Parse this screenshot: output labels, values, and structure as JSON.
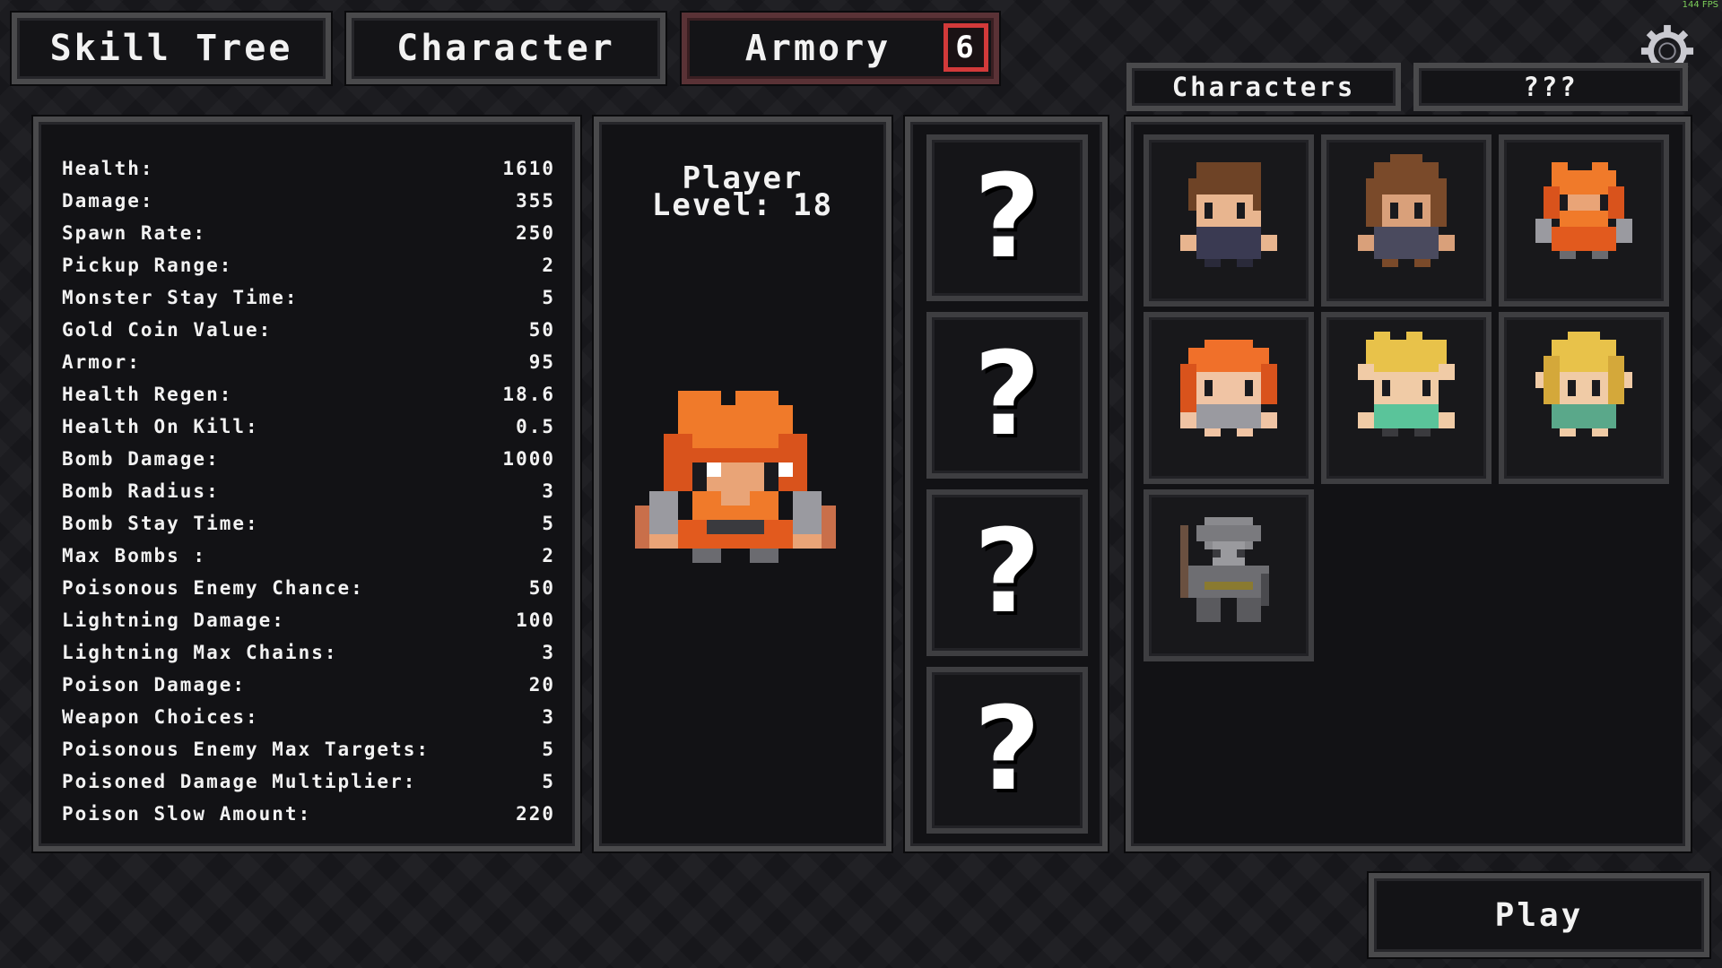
{
  "tabs": {
    "skill_tree": "Skill Tree",
    "character": "Character",
    "armory": "Armory",
    "armory_badge": "6"
  },
  "fps": "144 FPS",
  "stats": [
    {
      "label": "Health:",
      "value": "1610"
    },
    {
      "label": "Damage:",
      "value": "355"
    },
    {
      "label": "Spawn Rate:",
      "value": "250"
    },
    {
      "label": "Pickup Range:",
      "value": "2"
    },
    {
      "label": "Monster Stay Time:",
      "value": "5"
    },
    {
      "label": "Gold Coin Value:",
      "value": "50"
    },
    {
      "label": "Armor:",
      "value": "95"
    },
    {
      "label": "Health Regen:",
      "value": "18.6"
    },
    {
      "label": "Health On Kill:",
      "value": "0.5"
    },
    {
      "label": "Bomb Damage:",
      "value": "1000"
    },
    {
      "label": "Bomb Radius:",
      "value": "3"
    },
    {
      "label": "Bomb Stay Time:",
      "value": "5"
    },
    {
      "label": "Max Bombs :",
      "value": "2"
    },
    {
      "label": "Poisonous Enemy Chance:",
      "value": "50"
    },
    {
      "label": "Lightning Damage:",
      "value": "100"
    },
    {
      "label": "Lightning Max Chains:",
      "value": "3"
    },
    {
      "label": "Poison Damage:",
      "value": "20"
    },
    {
      "label": "Weapon Choices:",
      "value": "3"
    },
    {
      "label": "Poisonous Enemy Max Targets:",
      "value": "5"
    },
    {
      "label": "Poisoned Damage Multiplier:",
      "value": "5"
    },
    {
      "label": "Poison Slow Amount:",
      "value": "220"
    }
  ],
  "player": {
    "line1": "Player",
    "line2": "Level: 18",
    "sprite": "orange-haired-bearded-warrior"
  },
  "mystery_slots": [
    "?",
    "?",
    "?",
    "?"
  ],
  "character_tabs": {
    "characters": "Characters",
    "unknown": "???"
  },
  "characters": [
    "brown-haired-boy",
    "brown-haired-girl",
    "orange-haired-warrior",
    "orange-haired-girl",
    "blonde-elf-boy",
    "blonde-elf-girl",
    "locked-gray-knight"
  ],
  "play_label": "Play",
  "icons": {
    "settings": "gear-icon"
  },
  "colors": {
    "badge_border": "#d23a3a",
    "armory_tab_border": "#5a3236",
    "panel_border": "#4a4a4c"
  }
}
